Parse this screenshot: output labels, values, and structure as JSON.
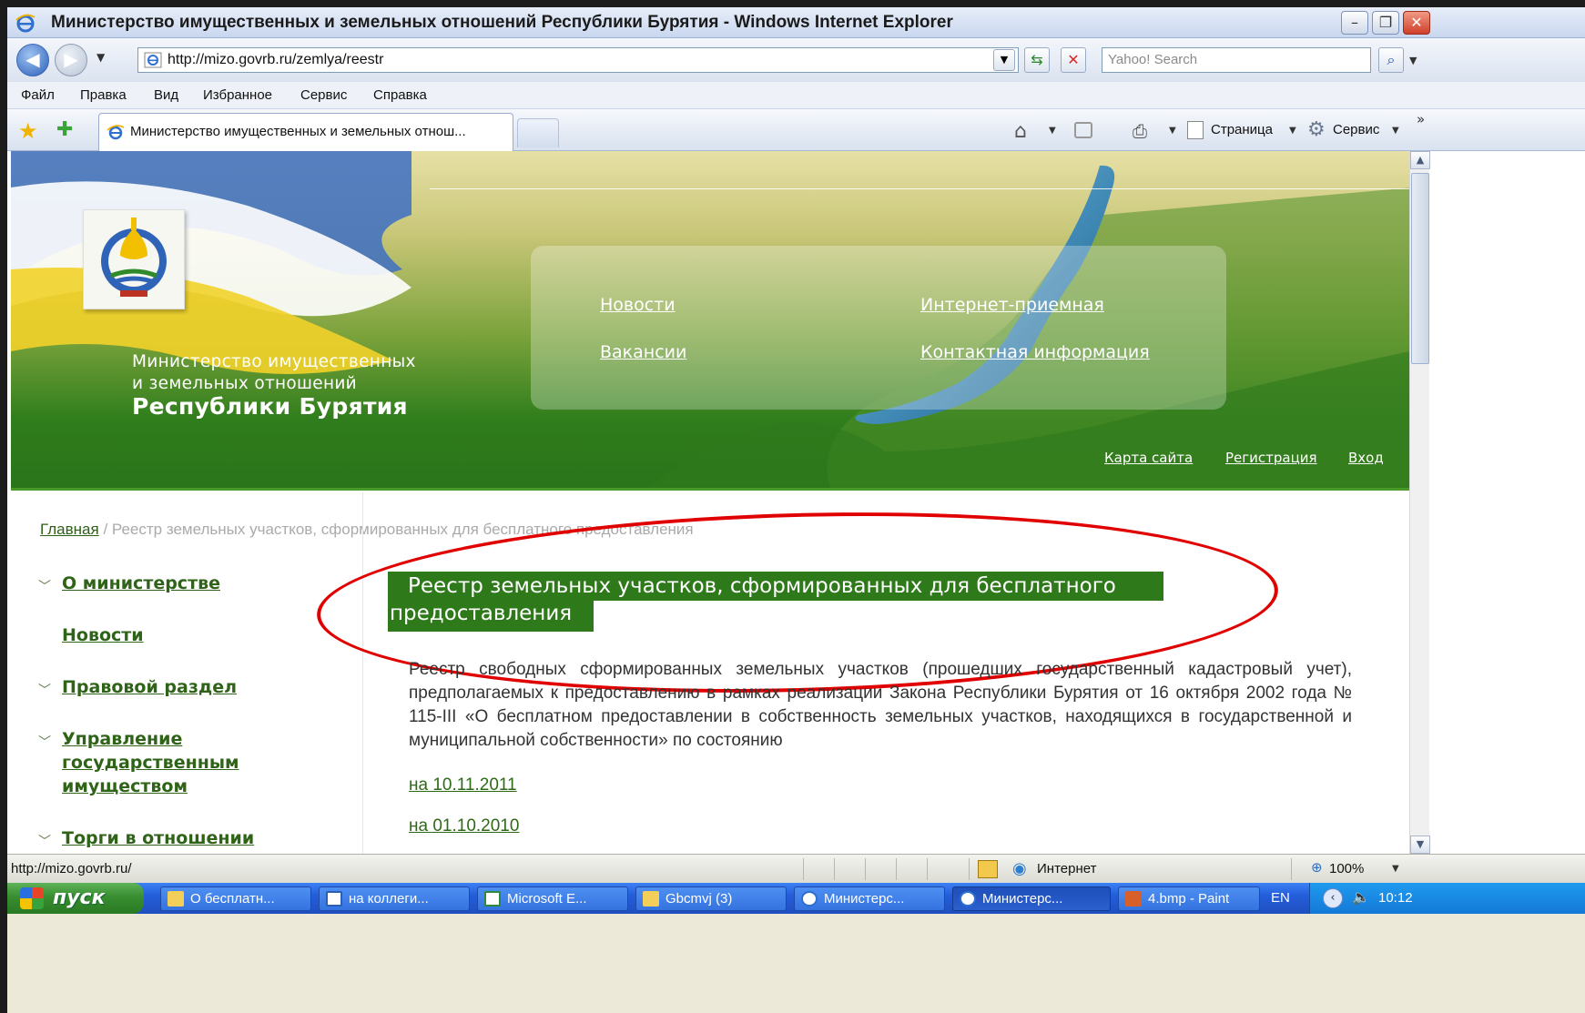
{
  "window": {
    "title": "Министерство имущественных и земельных отношений Республики Бурятия - Windows Internet Explorer"
  },
  "address_bar": {
    "url": "http://mizo.govrb.ru/zemlya/reestr",
    "search_placeholder": "Yahoo! Search"
  },
  "menu": [
    "Файл",
    "Правка",
    "Вид",
    "Избранное",
    "Сервис",
    "Справка"
  ],
  "tab": {
    "title": "Министерство имущественных и земельных отнош..."
  },
  "commands": {
    "page": "Страница",
    "tools": "Сервис"
  },
  "site": {
    "ministry_line1": "Министерство имущественных",
    "ministry_line2": "и земельных отношений",
    "republic": "Республики Бурятия",
    "nav": [
      "Новости",
      "Интернет-приемная",
      "Вакансии",
      "Контактная информация"
    ],
    "util": [
      "Карта сайта",
      "Регистрация",
      "Вход"
    ]
  },
  "breadcrumb": {
    "home": "Главная",
    "sep": " / ",
    "current": "Реестр земельных участков, сформированных для бесплатного предоставления"
  },
  "left_nav": [
    "О министерстве",
    "Новости",
    "Правовой раздел",
    "Управление государственным имуществом",
    "Торги в отношении"
  ],
  "page": {
    "title_line1": "Реестр земельных участков, сформированных для бесплатного",
    "title_line2": "предоставления",
    "description": "Реестр свободных сформированных земельных участков (прошедших государственный кадастровый учет), предполагаемых к предоставлению в рамках реализации Закона Республики Бурятия от 16 октября 2002 года № 115-III «О бесплатном предоставлении в собственность земельных участков, находящихся в государственной и муниципальной собственности» по состоянию",
    "dates": [
      "на 10.11.2011",
      "на 01.10.2010"
    ]
  },
  "status": {
    "url": "http://mizo.govrb.ru/",
    "zone": "Интернет",
    "zoom": "100%"
  },
  "taskbar": {
    "start": "пуск",
    "tasks": [
      "О бесплатн...",
      "на коллеги...",
      "Microsoft E...",
      "Gbcmvj (3)",
      "Министерс...",
      "Министерс...",
      "4.bmp - Paint"
    ],
    "lang": "EN",
    "clock": "10:12"
  },
  "colors": {
    "accent_green": "#2e7a1a",
    "link_green": "#2f6418",
    "highlight_red": "#e10000",
    "xp_blue": "#245edb"
  }
}
